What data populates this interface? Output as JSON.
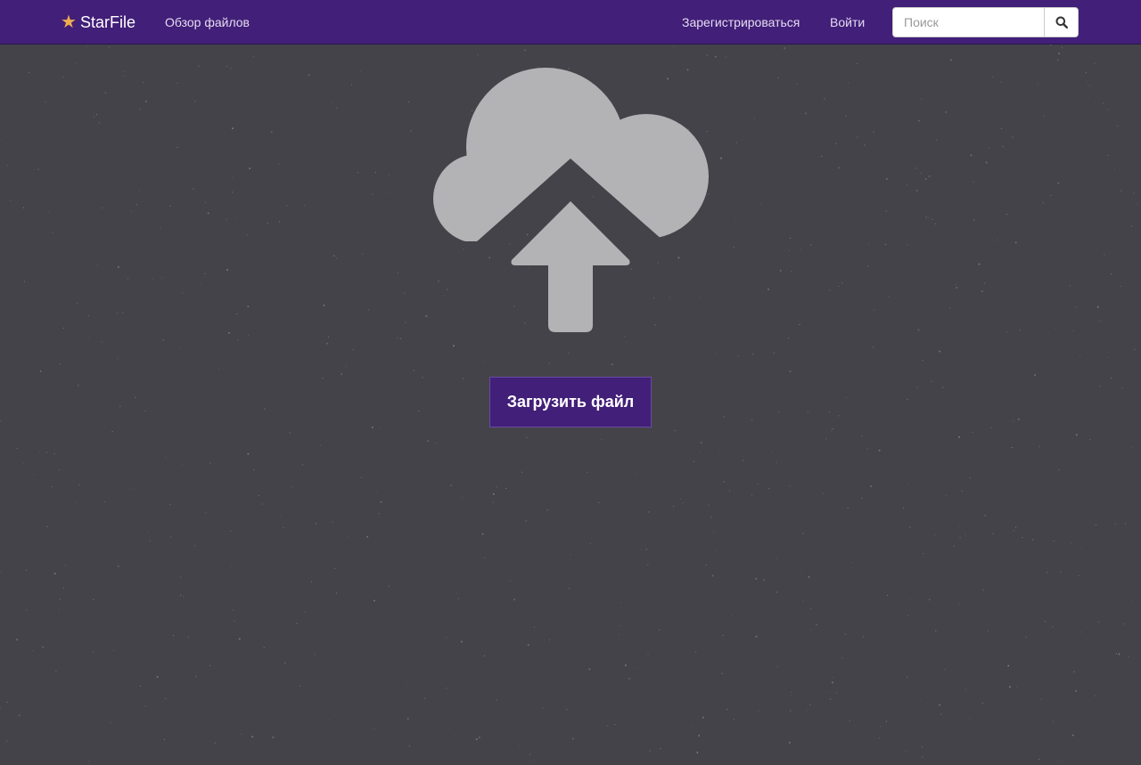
{
  "navbar": {
    "brand": {
      "icon": "star-icon",
      "icon_color": "#f0ad4e",
      "label": "StarFile"
    },
    "links": {
      "browse": "Обзор файлов",
      "register": "Зарегистрироваться",
      "login": "Войти"
    },
    "search": {
      "placeholder": "Поиск",
      "value": "",
      "button_icon": "search-icon"
    },
    "background_color": "#421f78"
  },
  "main": {
    "hero_icon": "cloud-upload-icon",
    "upload_button_label": "Загрузить файл",
    "background_color": "#444349"
  }
}
